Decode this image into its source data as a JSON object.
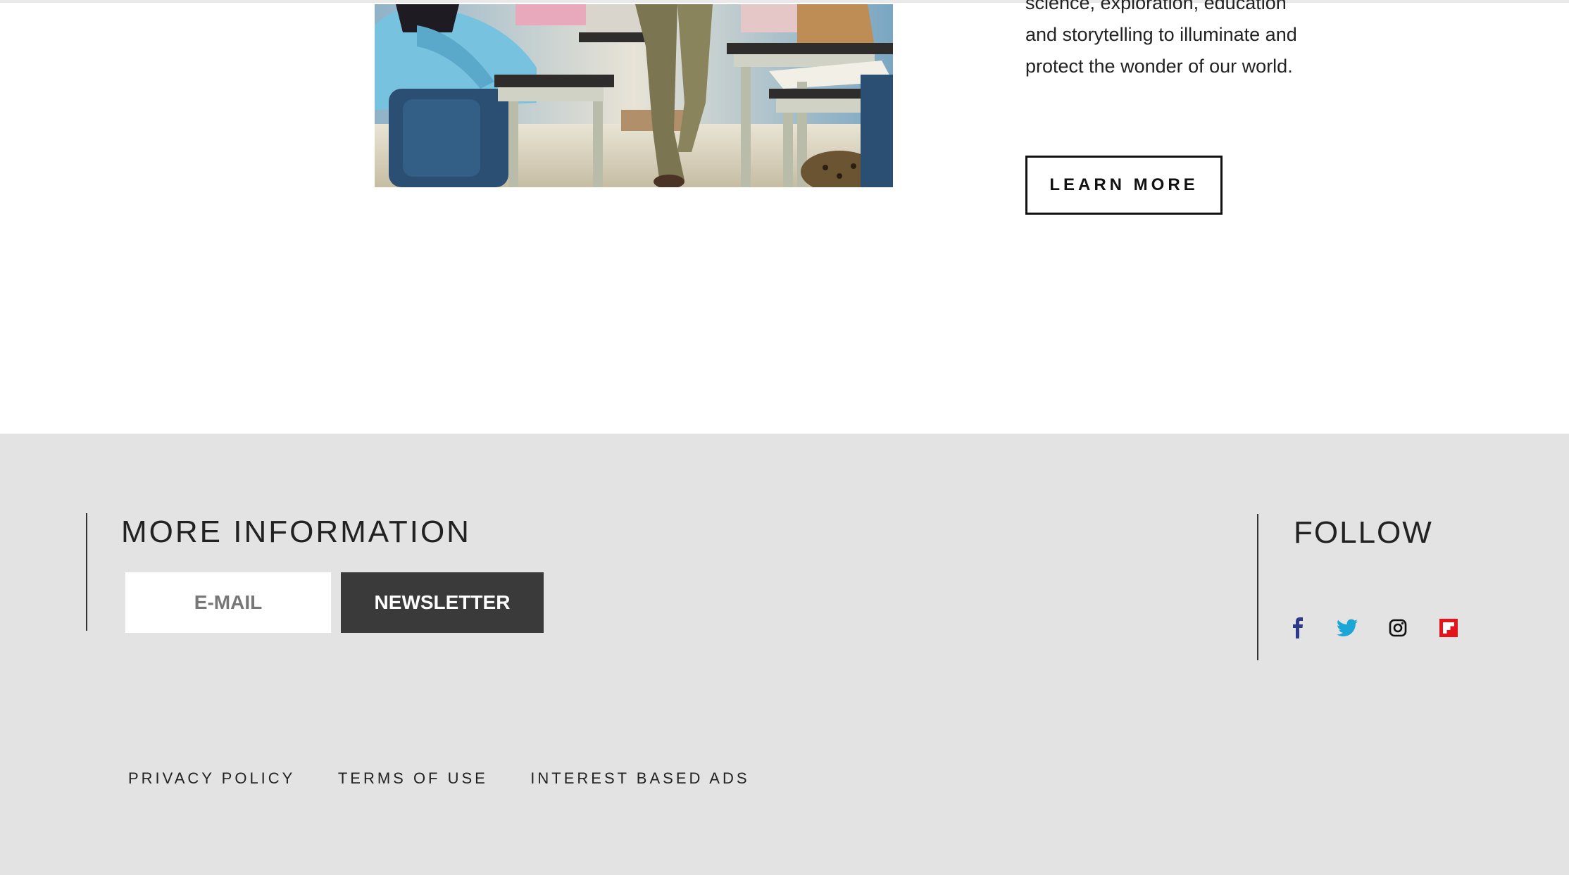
{
  "content": {
    "photo_alt": "Students seated at classroom desks with a teacher walking between rows",
    "mission_lines": [
      "science, exploration, education",
      "and storytelling to illuminate and",
      "protect the wonder of our world."
    ],
    "learn_more_label": "LEARN MORE"
  },
  "footer": {
    "background": "#e3e3e3",
    "more_info_title": "MORE INFORMATION",
    "email_placeholder": "E-MAIL",
    "newsletter_label": "NEWSLETTER",
    "follow_title": "FOLLOW",
    "social": [
      {
        "name": "facebook-icon",
        "color": "#2d3a8c"
      },
      {
        "name": "twitter-icon",
        "color": "#1aa6d6"
      },
      {
        "name": "instagram-icon",
        "color": "#111111"
      },
      {
        "name": "flipboard-icon",
        "color": "#e5141b"
      }
    ],
    "links": [
      "PRIVACY POLICY",
      "TERMS OF USE",
      "INTEREST BASED ADS"
    ]
  }
}
